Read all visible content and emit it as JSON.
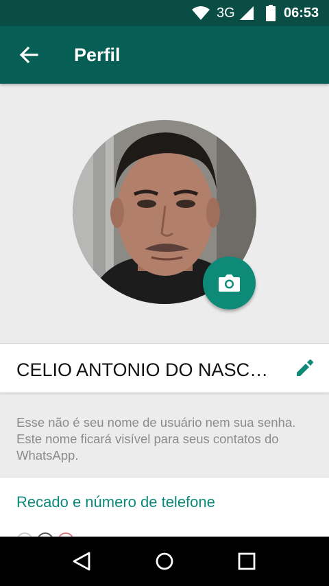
{
  "status_bar": {
    "network": "3G",
    "time": "06:53",
    "icons": [
      "wifi-icon",
      "signal-icon",
      "battery-icon"
    ]
  },
  "app_bar": {
    "title": "Perfil",
    "back_icon": "arrow-left-icon"
  },
  "profile": {
    "photo_alt": "profile-photo",
    "camera_icon": "camera-icon",
    "name": "CELIO ANTONIO DO NASCI…",
    "edit_icon": "pencil-icon"
  },
  "hint": {
    "text": "Esse não é seu nome de usuário nem sua senha. Este nome ficará visível para seus contatos do WhatsApp."
  },
  "about": {
    "heading": "Recado e número de telefone"
  },
  "nav_bar": {
    "icons": [
      "back-triangle-icon",
      "home-circle-icon",
      "recents-square-icon"
    ]
  },
  "colors": {
    "status_bar": "#0a4d45",
    "app_bar": "#075e54",
    "accent": "#0e8a78",
    "background": "#ececec"
  }
}
